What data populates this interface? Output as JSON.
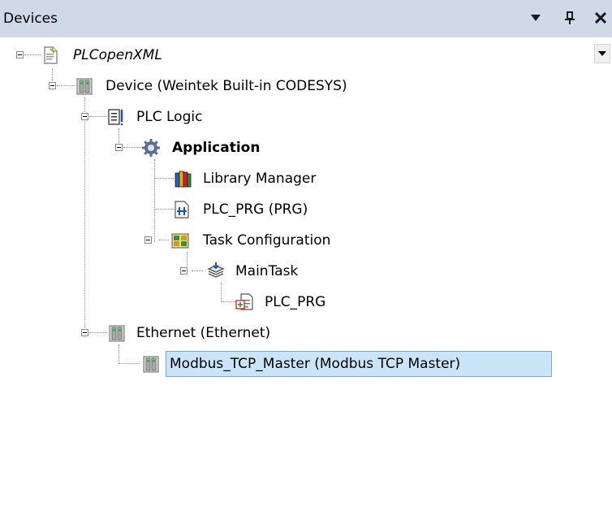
{
  "panel": {
    "title": "Devices",
    "dropdown_icon": "triangle-down-icon",
    "pin_icon": "pin-icon",
    "close_icon": "close-icon"
  },
  "tree": {
    "nodes": [
      {
        "label": "PLCopenXML",
        "icon": "xml-document-icon",
        "expanded": true
      },
      {
        "label": "Device (Weintek Built-in CODESYS)",
        "icon": "device-icon",
        "expanded": true
      },
      {
        "label": "PLC Logic",
        "icon": "plc-logic-icon",
        "expanded": true
      },
      {
        "label": "Application",
        "icon": "application-gear-icon",
        "expanded": true
      },
      {
        "label": "Library Manager",
        "icon": "library-books-icon"
      },
      {
        "label": "PLC_PRG (PRG)",
        "icon": "program-icon"
      },
      {
        "label": "Task Configuration",
        "icon": "task-configuration-icon",
        "expanded": true
      },
      {
        "label": "MainTask",
        "icon": "task-stack-icon",
        "expanded": true
      },
      {
        "label": "PLC_PRG",
        "icon": "program-call-icon"
      },
      {
        "label": "Ethernet (Ethernet)",
        "icon": "device-icon",
        "expanded": true
      },
      {
        "label": "Modbus_TCP_Master (Modbus TCP Master)",
        "icon": "device-icon",
        "selected": true
      }
    ]
  },
  "colors": {
    "titlebar": "#cfd9e8",
    "selection_fill": "#cce4f7",
    "selection_border": "#7aa8d6"
  }
}
